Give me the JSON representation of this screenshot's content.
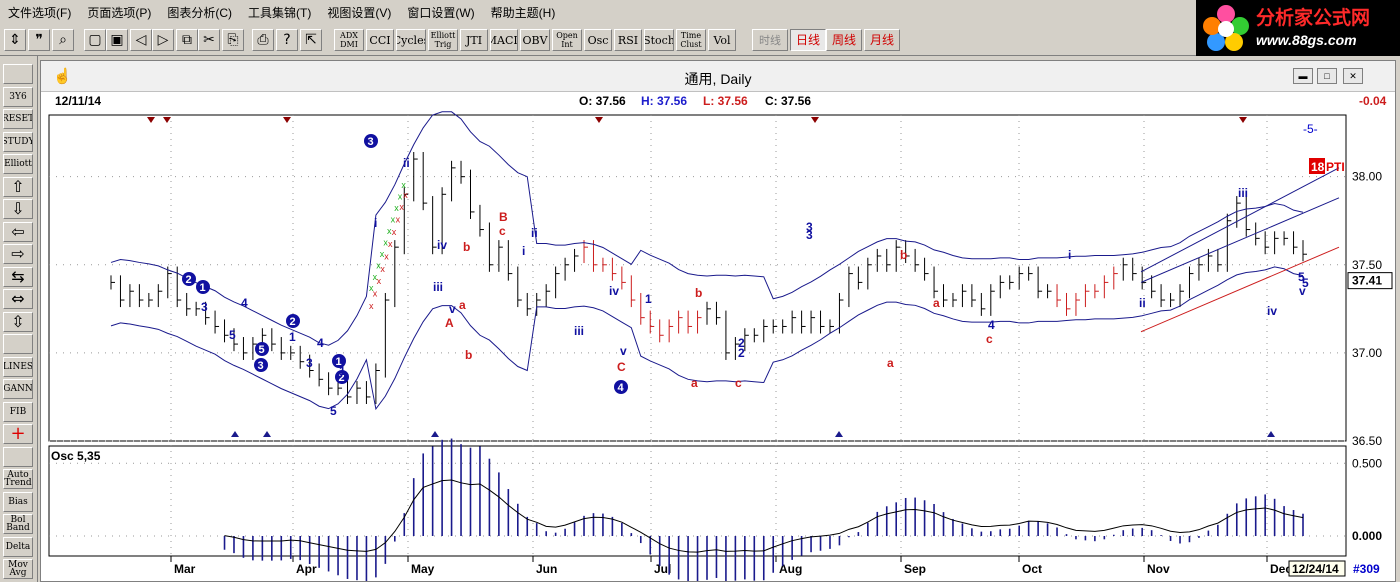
{
  "menubar": [
    "文件选项(F)",
    "页面选项(P)",
    "图表分析(C)",
    "工具集锦(T)",
    "视图设置(V)",
    "窗口设置(W)",
    "帮助主题(H)"
  ],
  "brand": {
    "title": "分析家公式网",
    "url": "www.88gs.com"
  },
  "toolbar": {
    "icons": [
      "cursor-arrow-icon",
      "quote-icon",
      "zoom-icon",
      "new-page-icon",
      "save-icon",
      "back-icon",
      "forward-icon",
      "copy-icon",
      "cut-icon",
      "paste-icon",
      "print-icon",
      "help-icon",
      "help-pointer-icon"
    ],
    "indicators": [
      {
        "label": "ADX DMI"
      },
      {
        "label": "CCI"
      },
      {
        "label": "Cycles"
      },
      {
        "label": "Elliott Trig"
      },
      {
        "label": "JTI"
      },
      {
        "label": "MACD"
      },
      {
        "label": "OBV"
      },
      {
        "label": "Open Int"
      },
      {
        "label": "Osc"
      },
      {
        "label": "RSI"
      },
      {
        "label": "Stoch"
      },
      {
        "label": "Time Clust"
      },
      {
        "label": "Vol"
      }
    ],
    "periods": [
      {
        "label": "时线",
        "active": false
      },
      {
        "label": "日线",
        "active": true
      },
      {
        "label": "周线",
        "active": false
      },
      {
        "label": "月线",
        "active": false
      }
    ]
  },
  "sidebar": [
    {
      "name": "open-folder-icon",
      "label": ""
    },
    {
      "name": "profile-button",
      "label": "3Y6"
    },
    {
      "name": "reset-button",
      "label": "RESET"
    },
    {
      "name": "study-button",
      "label": "STUDY"
    },
    {
      "name": "elliott-button",
      "label": "Elliott"
    },
    {
      "name": "arrow-up-icon",
      "label": "⇧"
    },
    {
      "name": "arrow-down-icon",
      "label": "⇩"
    },
    {
      "name": "arrow-left-icon",
      "label": "⇦"
    },
    {
      "name": "arrow-right-icon",
      "label": "⇨"
    },
    {
      "name": "compress-icon",
      "label": "⇆"
    },
    {
      "name": "expand-icon",
      "label": "⇔"
    },
    {
      "name": "vertical-scale-icon",
      "label": "⇳"
    },
    {
      "name": "grid-icon",
      "label": ""
    },
    {
      "name": "lines-button",
      "label": "LINES"
    },
    {
      "name": "gann-button",
      "label": "GANN"
    },
    {
      "name": "fib-button",
      "label": "FIB"
    },
    {
      "name": "crosshair-icon",
      "label": "+"
    },
    {
      "name": "edit-icon",
      "label": ""
    },
    {
      "name": "auto-trend-button",
      "label": "Auto Trend"
    },
    {
      "name": "bias-button",
      "label": "Bias"
    },
    {
      "name": "bol-band-button",
      "label": "Bol Band"
    },
    {
      "name": "delta-button",
      "label": "Delta"
    },
    {
      "name": "mov-avg-button",
      "label": "Mov Avg"
    }
  ],
  "window": {
    "title": "通用, Daily"
  },
  "info": {
    "date": "12/11/14",
    "open": "O: 37.56",
    "high": "H: 37.56",
    "low": "L: 37.56",
    "close": "C: 37.56",
    "change": "-0.04"
  },
  "chart_data": {
    "type": "line",
    "price_ticks": [
      "38.00",
      "37.50",
      "37.00",
      "36.50"
    ],
    "current_price": "37.41",
    "osc_title": "Osc 5,35",
    "osc_ticks": [
      "0.500",
      "0.000"
    ],
    "months": [
      "Mar",
      "Apr",
      "May",
      "Jun",
      "Jul",
      "Aug",
      "Sep",
      "Oct",
      "Nov",
      "Dec"
    ],
    "last_date": "12/24/14",
    "bar_count": "#309",
    "top_labels": [
      "-5-",
      "18",
      "PTI"
    ],
    "close_series": [
      37.4,
      37.3,
      37.35,
      37.3,
      37.3,
      37.35,
      37.45,
      37.3,
      37.25,
      37.25,
      37.2,
      37.15,
      37.1,
      37.05,
      37.0,
      37.05,
      37.1,
      37.05,
      37.0,
      37.0,
      36.95,
      36.9,
      36.85,
      36.8,
      36.8,
      36.75,
      36.8,
      36.75,
      36.9,
      37.3,
      37.6,
      37.9,
      38.1,
      37.85,
      37.6,
      37.9,
      38.05,
      38.0,
      37.8,
      37.7,
      37.5,
      37.6,
      37.45,
      37.3,
      37.25,
      37.3,
      37.35,
      37.45,
      37.5,
      37.55,
      37.6,
      37.5,
      37.5,
      37.45,
      37.4,
      37.3,
      37.2,
      37.15,
      37.1,
      37.15,
      37.2,
      37.15,
      37.2,
      37.25,
      37.2,
      37.0,
      37.05,
      37.1,
      37.1,
      37.15,
      37.15,
      37.15,
      37.2,
      37.15,
      37.2,
      37.15,
      37.15,
      37.3,
      37.45,
      37.4,
      37.5,
      37.55,
      37.5,
      37.6,
      37.55,
      37.5,
      37.45,
      37.35,
      37.3,
      37.3,
      37.35,
      37.3,
      37.25,
      37.35,
      37.4,
      37.4,
      37.45,
      37.45,
      37.35,
      37.35,
      37.3,
      37.25,
      37.3,
      37.35,
      37.35,
      37.4,
      37.45,
      37.5,
      37.45,
      37.4,
      37.35,
      37.3,
      37.3,
      37.35,
      37.45,
      37.5,
      37.55,
      37.5,
      37.75,
      37.85,
      37.7,
      37.65,
      37.6,
      37.65,
      37.65,
      37.6,
      37.56
    ]
  },
  "waves": {
    "blue": [
      "2",
      "1",
      "3",
      "5",
      "4",
      "2",
      "1",
      "3",
      "4",
      "1",
      "5",
      "2",
      "5",
      "3",
      "3",
      "i",
      "ii",
      "iv",
      "iii",
      "v",
      "ii",
      "i",
      "iii",
      "iv",
      "1",
      "2",
      "3",
      "i",
      "ii",
      "iii",
      "iv",
      "5",
      "v",
      "4",
      "1",
      "2",
      "3",
      "4",
      "5",
      "v",
      "v",
      "2",
      "4",
      "5"
    ],
    "red": [
      "B",
      "c",
      "b",
      "a",
      "A",
      "b",
      "a",
      "c",
      "b",
      "a",
      "C",
      "c",
      "b",
      "a"
    ]
  }
}
